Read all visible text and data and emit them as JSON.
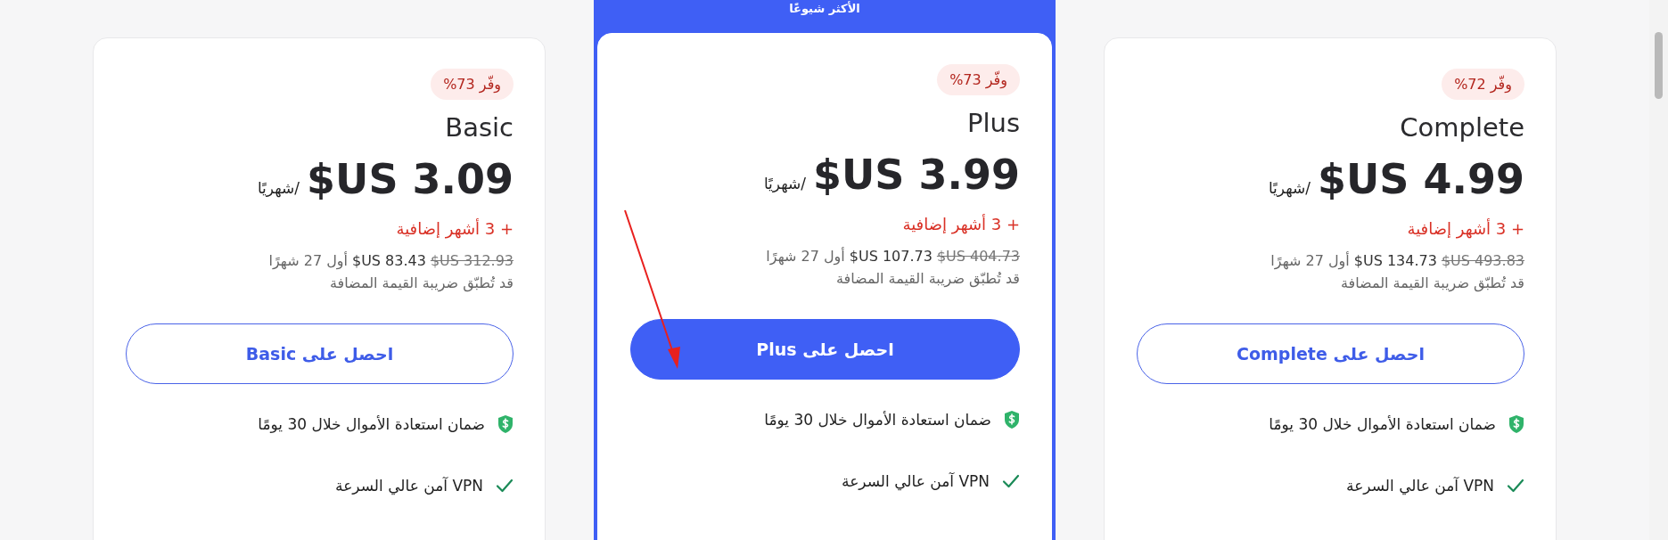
{
  "plans": [
    {
      "name": "Complete",
      "featured": false,
      "badge": "وفّر 72%",
      "price": "$US 4.99",
      "period": "/شهريًا",
      "bonus": "+ 3 أشهر إضافية",
      "original_price": "$US 493.83",
      "intro_price": "$US 134.73",
      "intro_term": "أول 27 شهرًا",
      "tax_note": "قد تُطبّق ضريبة القيمة المضافة",
      "button": "احصل على Complete",
      "features": [
        {
          "kind": "guarantee",
          "text": "ضمان استعادة الأموال خلال 30 يومًا"
        },
        {
          "kind": "check",
          "text": "VPN آمن عالي السرعة"
        }
      ]
    },
    {
      "name": "Plus",
      "featured": true,
      "ribbon": "الأكثر شيوعًا",
      "badge": "وفّر 73%",
      "price": "$US 3.99",
      "period": "/شهريًا",
      "bonus": "+ 3 أشهر إضافية",
      "original_price": "$US 404.73",
      "intro_price": "$US 107.73",
      "intro_term": "أول 27 شهرًا",
      "tax_note": "قد تُطبّق ضريبة القيمة المضافة",
      "button": "احصل على Plus",
      "features": [
        {
          "kind": "guarantee",
          "text": "ضمان استعادة الأموال خلال 30 يومًا"
        },
        {
          "kind": "check",
          "text": "VPN آمن عالي السرعة"
        }
      ]
    },
    {
      "name": "Basic",
      "featured": false,
      "badge": "وفّر 73%",
      "price": "$US 3.09",
      "period": "/شهريًا",
      "bonus": "+ 3 أشهر إضافية",
      "original_price": "$US 312.93",
      "intro_price": "$US 83.43",
      "intro_term": "أول 27 شهرًا",
      "tax_note": "قد تُطبّق ضريبة القيمة المضافة",
      "button": "احصل على Basic",
      "features": [
        {
          "kind": "guarantee",
          "text": "ضمان استعادة الأموال خلال 30 يومًا"
        },
        {
          "kind": "check",
          "text": "VPN آمن عالي السرعة"
        }
      ]
    }
  ]
}
